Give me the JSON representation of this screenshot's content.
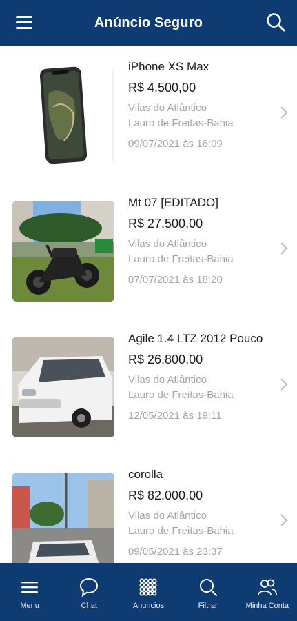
{
  "header": {
    "title": "Anúncio Seguro"
  },
  "colors": {
    "primary": "#0f3b73",
    "text": "#1b1b1b",
    "muted": "#a6a6a6"
  },
  "listings": [
    {
      "title": "iPhone XS Max",
      "price": "R$ 4.500,00",
      "neighborhood": "Vilas do Atlântico",
      "city": "Lauro de Freitas-Bahia",
      "date": "09/07/2021 às 16:09",
      "thumb_icon": "phone-photo"
    },
    {
      "title": "Mt 07 [EDITADO]",
      "price": "R$ 27.500,00",
      "neighborhood": "Vilas do Atlântico",
      "city": "Lauro de Freitas-Bahia",
      "date": "07/07/2021 às 18:20",
      "thumb_icon": "motorcycle-photo"
    },
    {
      "title": "Agile 1.4 LTZ 2012 Pouco",
      "price": "R$ 26.800,00",
      "neighborhood": "Vilas do Atlântico",
      "city": "Lauro de Freitas-Bahia",
      "date": "12/05/2021 às 19:11",
      "thumb_icon": "car-photo"
    },
    {
      "title": "corolla",
      "price": "R$ 82.000,00",
      "neighborhood": "Vilas do Atlântico",
      "city": "Lauro de Freitas-Bahia",
      "date": "09/05/2021 às 23:37",
      "thumb_icon": "car-street-photo"
    }
  ],
  "bottom_nav": [
    {
      "label": "Menu",
      "icon": "hamburger-icon"
    },
    {
      "label": "Chat",
      "icon": "chat-bubble-icon"
    },
    {
      "label": "Anuncios",
      "icon": "grid-icon"
    },
    {
      "label": "Filtrar",
      "icon": "search-icon"
    },
    {
      "label": "Minha Conta",
      "icon": "users-icon"
    }
  ]
}
